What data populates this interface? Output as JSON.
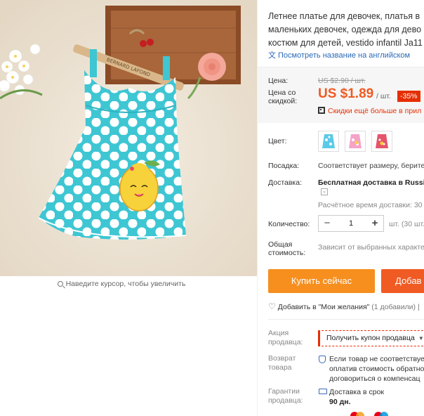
{
  "gallery": {
    "zoom_hint": "Наведите курсор, чтобы увеличить",
    "hanger_text": "BERNARD LAFOND"
  },
  "product": {
    "title_lines": [
      "Летнее платье для девочек, платья в",
      "маленьких девочек, одежда для дево",
      "костюм для детей, vestido infantil Ja11"
    ],
    "translate_link": "Посмотреть название на английском"
  },
  "price": {
    "price_label": "Цена:",
    "old_price": "US $2.90 / шт.",
    "discount_label_1": "Цена со",
    "discount_label_2": "скидкой:",
    "new_price": "US $1.89",
    "unit": "/ шт.",
    "discount_badge": "-35%",
    "qr_text": "Скидки ещё больше в прил"
  },
  "options": {
    "color_label": "Цвет:",
    "fit_label": "Посадка:",
    "fit_value": "Соответствует размеру, берите",
    "delivery_label": "Доставка:",
    "delivery_value": "Бесплатная доставка в Russia",
    "delivery_time": "Расчётное время доставки: 30",
    "quantity_label": "Количество:",
    "quantity_minus": "−",
    "quantity_value": "1",
    "quantity_plus": "+",
    "quantity_unit": "шт. (30 шт. д",
    "total_label_1": "Общая",
    "total_label_2": "стоимость:",
    "total_value": "Зависит от выбранных характе"
  },
  "actions": {
    "buy_now": "Купить сейчас",
    "add_to_cart": "Добав",
    "wishlist": "Добавить в \"Мои желания\"",
    "wishlist_count": "(1 добавили)",
    "wishlist_sep": "|"
  },
  "seller": {
    "promo_label_1": "Акция",
    "promo_label_2": "продавца:",
    "coupon_button": "Получить купон продавца",
    "return_label_1": "Возврат",
    "return_label_2": "товара",
    "return_lines": [
      "Если товар не соответствуе",
      "оплатив стоимость обратно",
      "договориться о компенсац"
    ],
    "guarantee_label_1": "Гарантии",
    "guarantee_label_2": "продавца:",
    "guarantee_line_1": "Доставка в срок",
    "guarantee_line_2": "90 дн."
  },
  "colors": {
    "price_orange": "#f05a23",
    "buy_orange": "#f68f1e",
    "discount_red": "#e62e04",
    "link_blue": "#2a6ab8",
    "dress_teal": "#38c8d4"
  }
}
